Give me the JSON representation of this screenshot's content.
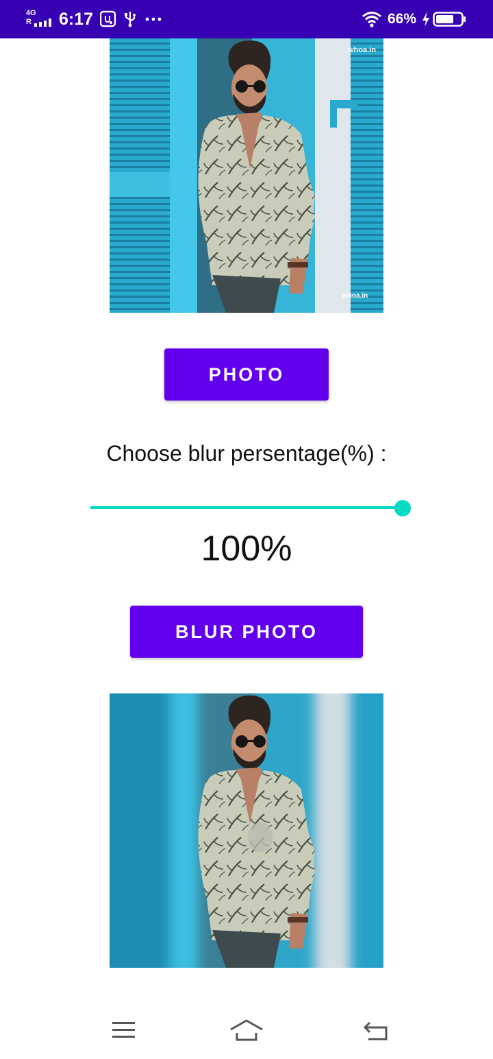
{
  "status_bar": {
    "network_type": "4G",
    "network_sub": "R",
    "time": "6:17",
    "battery_percent": "66%",
    "icons": [
      "signal-icon",
      "usb-debug-icon",
      "usb-icon",
      "more-notifications-icon",
      "wifi-icon",
      "charging-icon",
      "battery-icon"
    ],
    "colors": {
      "background": "#3700b3",
      "foreground": "#ffffff"
    }
  },
  "original_photo": {
    "watermarks": [
      "whoa.in",
      "whoa.in"
    ]
  },
  "photo_button": {
    "label": "PHOTO"
  },
  "blur_control": {
    "label": "Choose blur persentage(%) :",
    "value_text": "100%",
    "slider_value": 100,
    "slider_max": 100
  },
  "blur_button": {
    "label": "BLUR PHOTO"
  },
  "navigation_bar": {
    "icons": [
      "menu-icon",
      "home-icon",
      "back-icon"
    ]
  },
  "colors": {
    "accent": "#6200ee",
    "slider": "#03dac5",
    "status_bar": "#3700b3"
  }
}
